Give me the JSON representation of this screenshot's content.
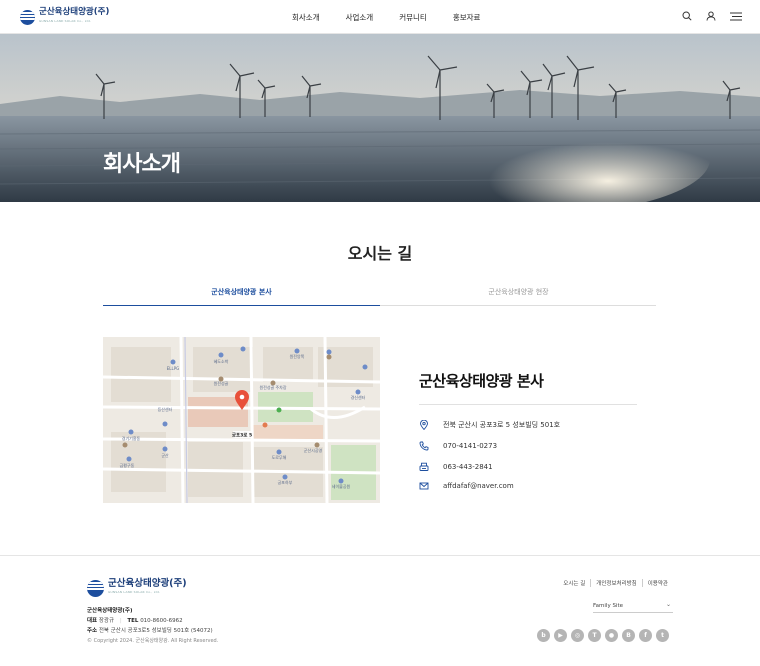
{
  "header": {
    "logo_text": "군산육상태양광(주)",
    "logo_sub": "GUNSAN LAND SOLAR Co., Ltd.",
    "nav": [
      "회사소개",
      "사업소개",
      "커뮤니티",
      "홍보자료"
    ]
  },
  "hero": {
    "title": "회사소개"
  },
  "section": {
    "title": "오시는 길"
  },
  "tabs": [
    "군산육상태양광 본사",
    "군산육상태양광 현장"
  ],
  "map": {
    "labels": [
      "ELLPG",
      "등산센터",
      "원전성골",
      "원전성골 주차장",
      "궁포3로 5",
      "금평구동",
      "군산",
      "경기기흥동",
      "군산시공영",
      "도로무해",
      "궁포하부",
      "세이블공원",
      "센터",
      "경신센터",
      "혜도소박",
      "원전앙쪽"
    ]
  },
  "info": {
    "title": "군산육상태양광 본사",
    "address": "전북 군산시 공포3로 5 성보빌딩 501호",
    "phone": "070-4141-0273",
    "fax": "063-443-2841",
    "email": "affdafaf@naver.com"
  },
  "footer": {
    "logo_text": "군산육상태양광(주)",
    "logo_sub": "GUNSAN LAND SOLAR Co., Ltd.",
    "company": "군산육상태양광(주)",
    "rep_label": "대표",
    "rep_name": "장광규",
    "tel_label": "TEL",
    "tel": "010-8600-6962",
    "addr_label": "주소",
    "addr": "전북 군산시 공포3로5 성보빌딩 501호 (54072)",
    "copyright": "© Copyright 2024. 군산육상태양광. All Right Reserved.",
    "links": [
      "오시는 길",
      "개인정보처리방침",
      "이용약관"
    ],
    "family_site": "Family Site",
    "sns": [
      "blog",
      "youtube",
      "instagram",
      "thread",
      "talk",
      "band",
      "facebook",
      "twitter"
    ]
  }
}
